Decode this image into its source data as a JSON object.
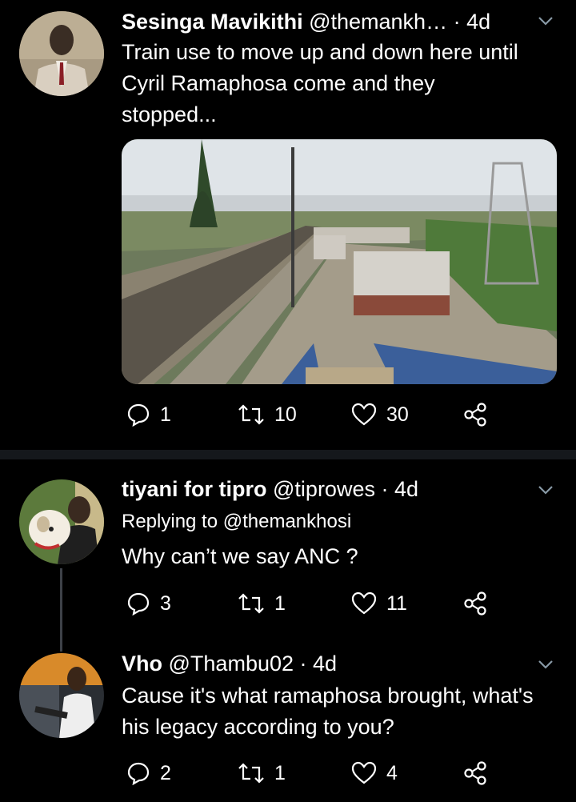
{
  "tweets": [
    {
      "name": "Sesinga Mavikithi",
      "handle": "@themankh…",
      "time": "· 4d",
      "text": "Train use to move up and down here until Cyril Ramaphosa come and they stopped...",
      "counts": {
        "replies": "1",
        "retweets": "10",
        "likes": "30"
      }
    },
    {
      "name": "tiyani for tipro",
      "handle": "@tiprowes",
      "time": "· 4d",
      "replying_to": "Replying to @themankhosi",
      "text": "Why can’t we say ANC ?",
      "counts": {
        "replies": "3",
        "retweets": "1",
        "likes": "11"
      }
    },
    {
      "name": "Vho",
      "handle": "@Thambu02",
      "time": "· 4d",
      "text": "Cause it's what ramaphosa brought, what's his legacy according to you?",
      "counts": {
        "replies": "2",
        "retweets": "1",
        "likes": "4"
      }
    }
  ],
  "colors": {
    "background": "#000000",
    "divider": "#15181c",
    "icon": "#ffffff",
    "muted": "#8899a6"
  },
  "icons": [
    "reply-icon",
    "retweet-icon",
    "like-icon",
    "share-icon",
    "chevron-down-icon"
  ]
}
